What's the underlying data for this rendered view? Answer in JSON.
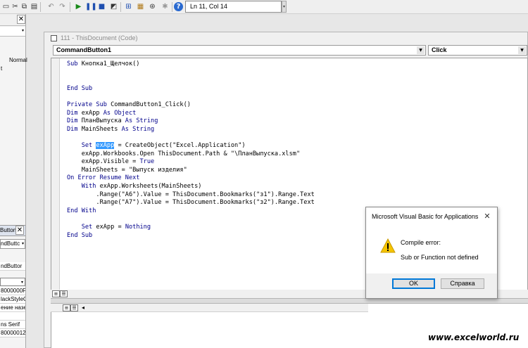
{
  "toolbar": {
    "status": "Ln 11, Col 14",
    "icons": [
      "save-icon",
      "cut-icon",
      "copy-icon",
      "paste-icon",
      "find-icon",
      "undo-icon",
      "redo-icon",
      "run-icon",
      "pause-icon",
      "reset-icon",
      "design-mode-icon",
      "project-explorer-icon",
      "properties-icon",
      "object-browser-icon",
      "toolbox-icon",
      "help-icon"
    ]
  },
  "left_panel": {
    "top_lines": [
      "Normal",
      "t"
    ],
    "properties_title": "Button",
    "properties_combo": "ndButtc",
    "rows": [
      "ndButtor",
      "",
      "8000000F",
      "lackStyleC",
      "ение назе",
      "",
      "ns Serif",
      "80000012"
    ]
  },
  "code_window": {
    "title": "111 - ThisDocument (Code)",
    "object_combo": "CommandButton1",
    "procedure_combo": "Click",
    "lines": [
      {
        "segs": [
          {
            "t": "Sub ",
            "k": 1
          },
          {
            "t": "Кнопка1_Щелчок()"
          }
        ]
      },
      {
        "segs": []
      },
      {
        "segs": []
      },
      {
        "segs": [
          {
            "t": "End Sub",
            "k": 1
          }
        ]
      },
      {
        "segs": []
      },
      {
        "segs": [
          {
            "t": "Private Sub ",
            "k": 1
          },
          {
            "t": "CommandButton1_Click()"
          }
        ]
      },
      {
        "segs": [
          {
            "t": "Dim ",
            "k": 1
          },
          {
            "t": "exApp "
          },
          {
            "t": "As Object",
            "k": 1
          }
        ]
      },
      {
        "segs": [
          {
            "t": "Dim ",
            "k": 1
          },
          {
            "t": "ПланВыпуска "
          },
          {
            "t": "As String",
            "k": 1
          }
        ]
      },
      {
        "segs": [
          {
            "t": "Dim ",
            "k": 1
          },
          {
            "t": "MainSheets "
          },
          {
            "t": "As String",
            "k": 1
          }
        ]
      },
      {
        "segs": []
      },
      {
        "segs": [
          {
            "t": "    Set ",
            "k": 1
          },
          {
            "t": "exApp",
            "h": 1
          },
          {
            "t": " = CreateObject(\"Excel.Application\")"
          }
        ]
      },
      {
        "segs": [
          {
            "t": "    exApp.Workbooks.Open ThisDocument.Path & \"\\ПланВыпуска.xlsm\""
          }
        ]
      },
      {
        "segs": [
          {
            "t": "    exApp.Visible = "
          },
          {
            "t": "True",
            "k": 1
          }
        ]
      },
      {
        "segs": [
          {
            "t": "    MainSheets = \"Выпуск изделия\""
          }
        ]
      },
      {
        "segs": [
          {
            "t": "On Error Resume Next",
            "k": 1
          }
        ]
      },
      {
        "segs": [
          {
            "t": "    With ",
            "k": 1
          },
          {
            "t": "exApp.Worksheets(MainSheets)"
          }
        ]
      },
      {
        "segs": [
          {
            "t": "        .Range(\"A6\").Value = ThisDocument.Bookmarks(\"з1\").Range.Text"
          }
        ]
      },
      {
        "segs": [
          {
            "t": "        .Range(\"A7\").Value = ThisDocument.Bookmarks(\"з2\").Range.Text"
          }
        ]
      },
      {
        "segs": [
          {
            "t": "End With",
            "k": 1
          }
        ]
      },
      {
        "segs": []
      },
      {
        "segs": [
          {
            "t": "    Set ",
            "k": 1
          },
          {
            "t": "exApp = "
          },
          {
            "t": "Nothing",
            "k": 1
          }
        ]
      },
      {
        "segs": [
          {
            "t": "End Sub",
            "k": 1
          }
        ]
      }
    ]
  },
  "dialog": {
    "title": "Microsoft Visual Basic for Applications",
    "line1": "Compile error:",
    "line2": "Sub or Function not defined",
    "ok_label": "OK",
    "help_label": "Справка"
  },
  "watermark": "www.excelworld.ru",
  "colors": {
    "keyword": "#00008b",
    "selection": "#3399ff",
    "dialog_focus": "#0078d7",
    "warning": "#f5c400"
  }
}
